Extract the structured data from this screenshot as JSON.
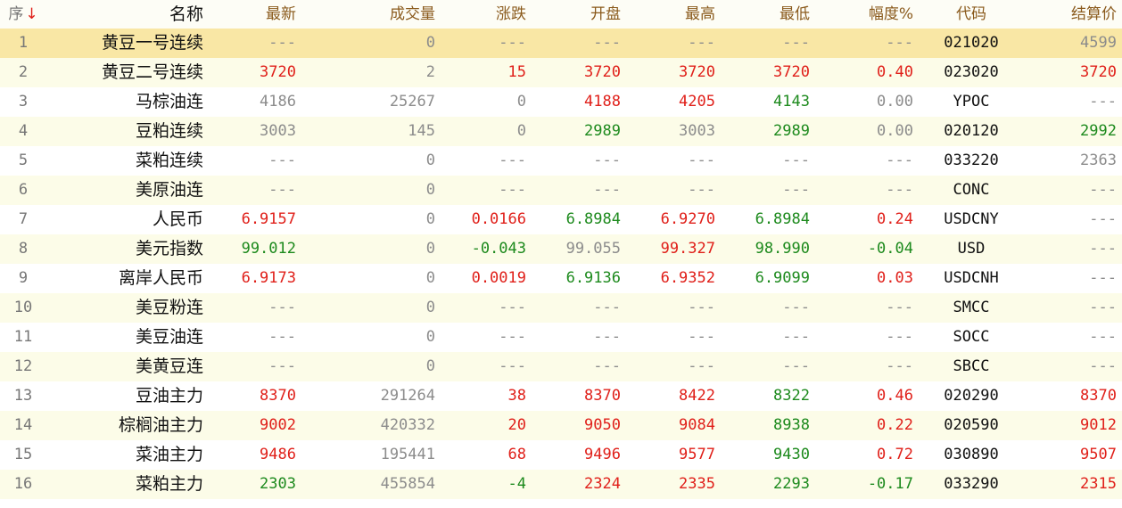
{
  "header": {
    "seq": "序",
    "sort_arrow": "↓",
    "name": "名称",
    "latest": "最新",
    "volume": "成交量",
    "change": "涨跌",
    "open": "开盘",
    "high": "最高",
    "low": "最低",
    "amplitude": "幅度%",
    "code": "代码",
    "settle": "结算价"
  },
  "colors": {
    "up": "#e0201a",
    "down": "#1d8a1d",
    "flat": "#8c8c8c",
    "selected_row": "#f9e7a5",
    "alt_row": "#fcfce8"
  },
  "selected_row": 1,
  "rows": [
    {
      "seq": "1",
      "name": "黄豆一号连续",
      "latest": "---",
      "latest_c": "gray",
      "volume": "0",
      "change": "---",
      "change_c": "gray",
      "open": "---",
      "open_c": "gray",
      "high": "---",
      "high_c": "gray",
      "low": "---",
      "low_c": "gray",
      "amplitude": "---",
      "amp_c": "gray",
      "code": "021020",
      "settle": "4599",
      "settle_c": "gray"
    },
    {
      "seq": "2",
      "name": "黄豆二号连续",
      "latest": "3720",
      "latest_c": "red",
      "volume": "2",
      "change": "15",
      "change_c": "red",
      "open": "3720",
      "open_c": "red",
      "high": "3720",
      "high_c": "red",
      "low": "3720",
      "low_c": "red",
      "amplitude": "0.40",
      "amp_c": "red",
      "code": "023020",
      "settle": "3720",
      "settle_c": "red"
    },
    {
      "seq": "3",
      "name": "马棕油连",
      "latest": "4186",
      "latest_c": "gray",
      "volume": "25267",
      "change": "0",
      "change_c": "gray",
      "open": "4188",
      "open_c": "red",
      "high": "4205",
      "high_c": "red",
      "low": "4143",
      "low_c": "green",
      "amplitude": "0.00",
      "amp_c": "gray",
      "code": "YPOC",
      "settle": "---",
      "settle_c": "gray"
    },
    {
      "seq": "4",
      "name": "豆粕连续",
      "latest": "3003",
      "latest_c": "gray",
      "volume": "145",
      "change": "0",
      "change_c": "gray",
      "open": "2989",
      "open_c": "green",
      "high": "3003",
      "high_c": "gray",
      "low": "2989",
      "low_c": "green",
      "amplitude": "0.00",
      "amp_c": "gray",
      "code": "020120",
      "settle": "2992",
      "settle_c": "green"
    },
    {
      "seq": "5",
      "name": "菜粕连续",
      "latest": "---",
      "latest_c": "gray",
      "volume": "0",
      "change": "---",
      "change_c": "gray",
      "open": "---",
      "open_c": "gray",
      "high": "---",
      "high_c": "gray",
      "low": "---",
      "low_c": "gray",
      "amplitude": "---",
      "amp_c": "gray",
      "code": "033220",
      "settle": "2363",
      "settle_c": "gray"
    },
    {
      "seq": "6",
      "name": "美原油连",
      "latest": "---",
      "latest_c": "gray",
      "volume": "0",
      "change": "---",
      "change_c": "gray",
      "open": "---",
      "open_c": "gray",
      "high": "---",
      "high_c": "gray",
      "low": "---",
      "low_c": "gray",
      "amplitude": "---",
      "amp_c": "gray",
      "code": "CONC",
      "settle": "---",
      "settle_c": "gray"
    },
    {
      "seq": "7",
      "name": "人民币",
      "latest": "6.9157",
      "latest_c": "red",
      "volume": "0",
      "change": "0.0166",
      "change_c": "red",
      "open": "6.8984",
      "open_c": "green",
      "high": "6.9270",
      "high_c": "red",
      "low": "6.8984",
      "low_c": "green",
      "amplitude": "0.24",
      "amp_c": "red",
      "code": "USDCNY",
      "settle": "---",
      "settle_c": "gray"
    },
    {
      "seq": "8",
      "name": "美元指数",
      "latest": "99.012",
      "latest_c": "green",
      "volume": "0",
      "change": "-0.043",
      "change_c": "green",
      "open": "99.055",
      "open_c": "gray",
      "high": "99.327",
      "high_c": "red",
      "low": "98.990",
      "low_c": "green",
      "amplitude": "-0.04",
      "amp_c": "green",
      "code": "USD",
      "settle": "---",
      "settle_c": "gray"
    },
    {
      "seq": "9",
      "name": "离岸人民币",
      "latest": "6.9173",
      "latest_c": "red",
      "volume": "0",
      "change": "0.0019",
      "change_c": "red",
      "open": "6.9136",
      "open_c": "green",
      "high": "6.9352",
      "high_c": "red",
      "low": "6.9099",
      "low_c": "green",
      "amplitude": "0.03",
      "amp_c": "red",
      "code": "USDCNH",
      "settle": "---",
      "settle_c": "gray"
    },
    {
      "seq": "10",
      "name": "美豆粉连",
      "latest": "---",
      "latest_c": "gray",
      "volume": "0",
      "change": "---",
      "change_c": "gray",
      "open": "---",
      "open_c": "gray",
      "high": "---",
      "high_c": "gray",
      "low": "---",
      "low_c": "gray",
      "amplitude": "---",
      "amp_c": "gray",
      "code": "SMCC",
      "settle": "---",
      "settle_c": "gray"
    },
    {
      "seq": "11",
      "name": "美豆油连",
      "latest": "---",
      "latest_c": "gray",
      "volume": "0",
      "change": "---",
      "change_c": "gray",
      "open": "---",
      "open_c": "gray",
      "high": "---",
      "high_c": "gray",
      "low": "---",
      "low_c": "gray",
      "amplitude": "---",
      "amp_c": "gray",
      "code": "SOCC",
      "settle": "---",
      "settle_c": "gray"
    },
    {
      "seq": "12",
      "name": "美黄豆连",
      "latest": "---",
      "latest_c": "gray",
      "volume": "0",
      "change": "---",
      "change_c": "gray",
      "open": "---",
      "open_c": "gray",
      "high": "---",
      "high_c": "gray",
      "low": "---",
      "low_c": "gray",
      "amplitude": "---",
      "amp_c": "gray",
      "code": "SBCC",
      "settle": "---",
      "settle_c": "gray"
    },
    {
      "seq": "13",
      "name": "豆油主力",
      "latest": "8370",
      "latest_c": "red",
      "volume": "291264",
      "change": "38",
      "change_c": "red",
      "open": "8370",
      "open_c": "red",
      "high": "8422",
      "high_c": "red",
      "low": "8322",
      "low_c": "green",
      "amplitude": "0.46",
      "amp_c": "red",
      "code": "020290",
      "settle": "8370",
      "settle_c": "red"
    },
    {
      "seq": "14",
      "name": "棕榈油主力",
      "latest": "9002",
      "latest_c": "red",
      "volume": "420332",
      "change": "20",
      "change_c": "red",
      "open": "9050",
      "open_c": "red",
      "high": "9084",
      "high_c": "red",
      "low": "8938",
      "low_c": "green",
      "amplitude": "0.22",
      "amp_c": "red",
      "code": "020590",
      "settle": "9012",
      "settle_c": "red"
    },
    {
      "seq": "15",
      "name": "菜油主力",
      "latest": "9486",
      "latest_c": "red",
      "volume": "195441",
      "change": "68",
      "change_c": "red",
      "open": "9496",
      "open_c": "red",
      "high": "9577",
      "high_c": "red",
      "low": "9430",
      "low_c": "green",
      "amplitude": "0.72",
      "amp_c": "red",
      "code": "030890",
      "settle": "9507",
      "settle_c": "red"
    },
    {
      "seq": "16",
      "name": "菜粕主力",
      "latest": "2303",
      "latest_c": "green",
      "volume": "455854",
      "change": "-4",
      "change_c": "green",
      "open": "2324",
      "open_c": "red",
      "high": "2335",
      "high_c": "red",
      "low": "2293",
      "low_c": "green",
      "amplitude": "-0.17",
      "amp_c": "green",
      "code": "033290",
      "settle": "2315",
      "settle_c": "red"
    }
  ]
}
